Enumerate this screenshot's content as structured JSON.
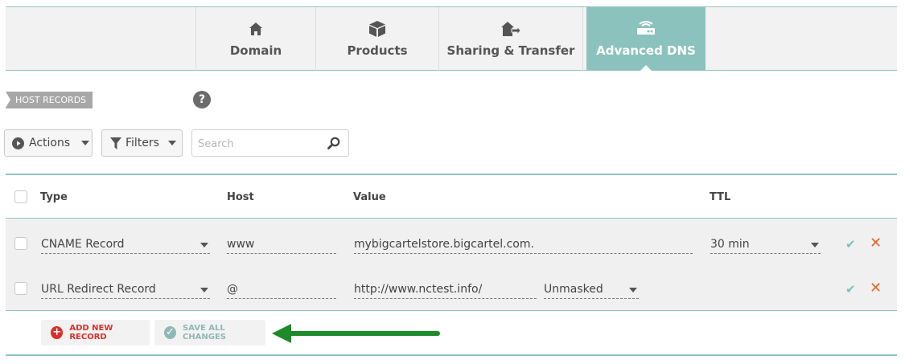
{
  "tabs": [
    {
      "label": "Domain",
      "icon": "home-icon"
    },
    {
      "label": "Products",
      "icon": "box-icon"
    },
    {
      "label": "Sharing & Transfer",
      "icon": "transfer-icon"
    },
    {
      "label": "Advanced DNS",
      "icon": "router-icon",
      "active": true
    }
  ],
  "section": {
    "label": "HOST RECORDS",
    "help": "?"
  },
  "toolbar": {
    "actions_label": "Actions",
    "filters_label": "Filters",
    "search_placeholder": "Search"
  },
  "table": {
    "headers": {
      "type": "Type",
      "host": "Host",
      "value": "Value",
      "ttl": "TTL"
    },
    "rows": [
      {
        "type": "CNAME Record",
        "host": "www",
        "value": "mybigcartelstore.bigcartel.com.",
        "ttl": "30 min"
      },
      {
        "type": "URL Redirect Record",
        "host": "@",
        "value": "http://www.nctest.info/",
        "redirect_mode": "Unmasked"
      }
    ]
  },
  "footer": {
    "add_label": "ADD NEW RECORD",
    "save_label": "SAVE ALL CHANGES"
  },
  "colors": {
    "accent": "#8bc2bd",
    "add": "#d9312a",
    "delete": "#e8642a",
    "arrow": "#1f8a2a"
  }
}
